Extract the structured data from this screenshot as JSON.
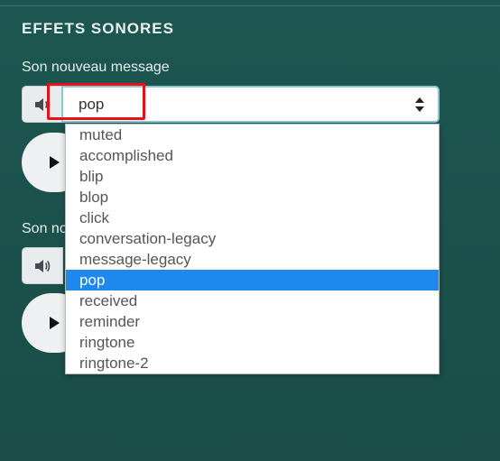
{
  "section": {
    "title": "EFFETS SONORES"
  },
  "field1": {
    "label": "Son nouveau message",
    "value": "pop"
  },
  "field2": {
    "label_partial": "Son no"
  },
  "dropdown": {
    "options": [
      "muted",
      "accomplished",
      "blip",
      "blop",
      "click",
      "conversation-legacy",
      "message-legacy",
      "pop",
      "received",
      "reminder",
      "ringtone",
      "ringtone-2"
    ],
    "selected": "pop"
  },
  "colors": {
    "background": "#1b5049",
    "selected_option": "#1e88ee",
    "highlight_box": "#e8111b"
  },
  "icons": {
    "speaker": "speaker-icon",
    "play": "play-icon",
    "arrows": "select-arrows-icon"
  }
}
